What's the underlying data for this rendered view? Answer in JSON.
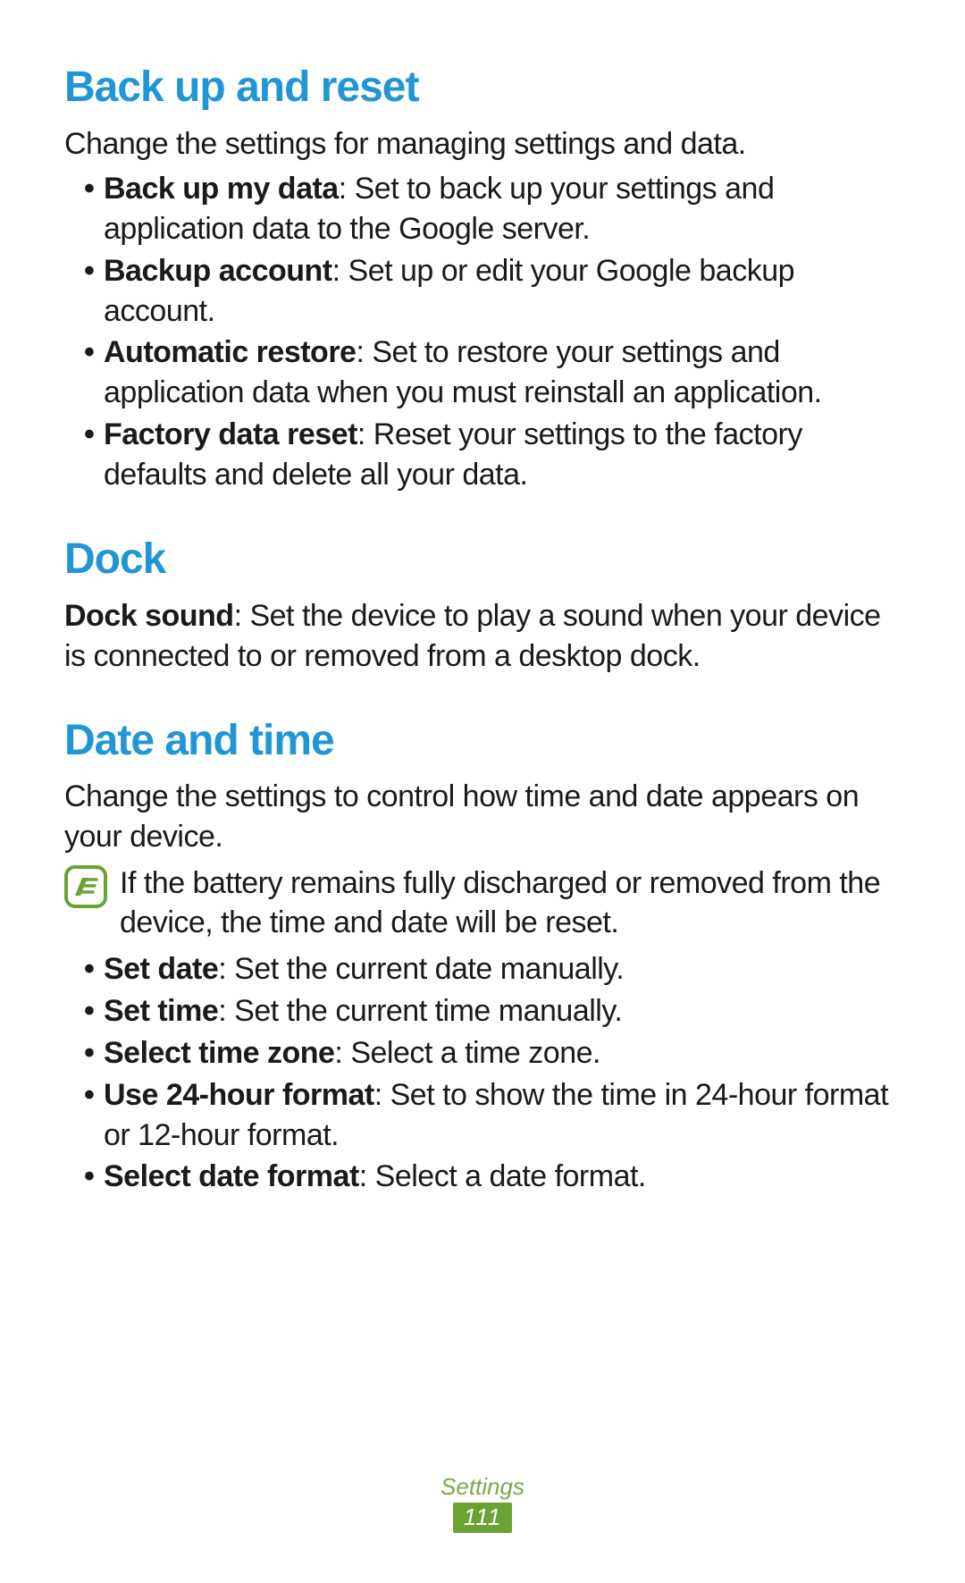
{
  "sections": {
    "backup": {
      "heading": "Back up and reset",
      "intro": "Change the settings for managing settings and data.",
      "items": [
        {
          "term": "Back up my data",
          "desc": ": Set to back up your settings and application data to the Google server."
        },
        {
          "term": "Backup account",
          "desc": ": Set up or edit your Google backup account."
        },
        {
          "term": "Automatic restore",
          "desc": ": Set to restore your settings and application data when you must reinstall an application."
        },
        {
          "term": "Factory data reset",
          "desc": ": Reset your settings to the factory defaults and delete all your data."
        }
      ]
    },
    "dock": {
      "heading": "Dock",
      "term": "Dock sound",
      "desc": ": Set the device to play a sound when your device is connected to or removed from a desktop dock."
    },
    "datetime": {
      "heading": "Date and time",
      "intro": "Change the settings to control how time and date appears on your device.",
      "note": "If the battery remains fully discharged or removed from the device, the time and date will be reset.",
      "items": [
        {
          "term": "Set date",
          "desc": ": Set the current date manually."
        },
        {
          "term": "Set time",
          "desc": ": Set the current time manually."
        },
        {
          "term": "Select time zone",
          "desc": ": Select a time zone."
        },
        {
          "term": "Use 24-hour format",
          "desc": ": Set to show the time in 24-hour format or 12-hour format."
        },
        {
          "term": "Select date format",
          "desc": ": Select a date format."
        }
      ]
    }
  },
  "footer": {
    "section_label": "Settings",
    "page_number": "111"
  }
}
